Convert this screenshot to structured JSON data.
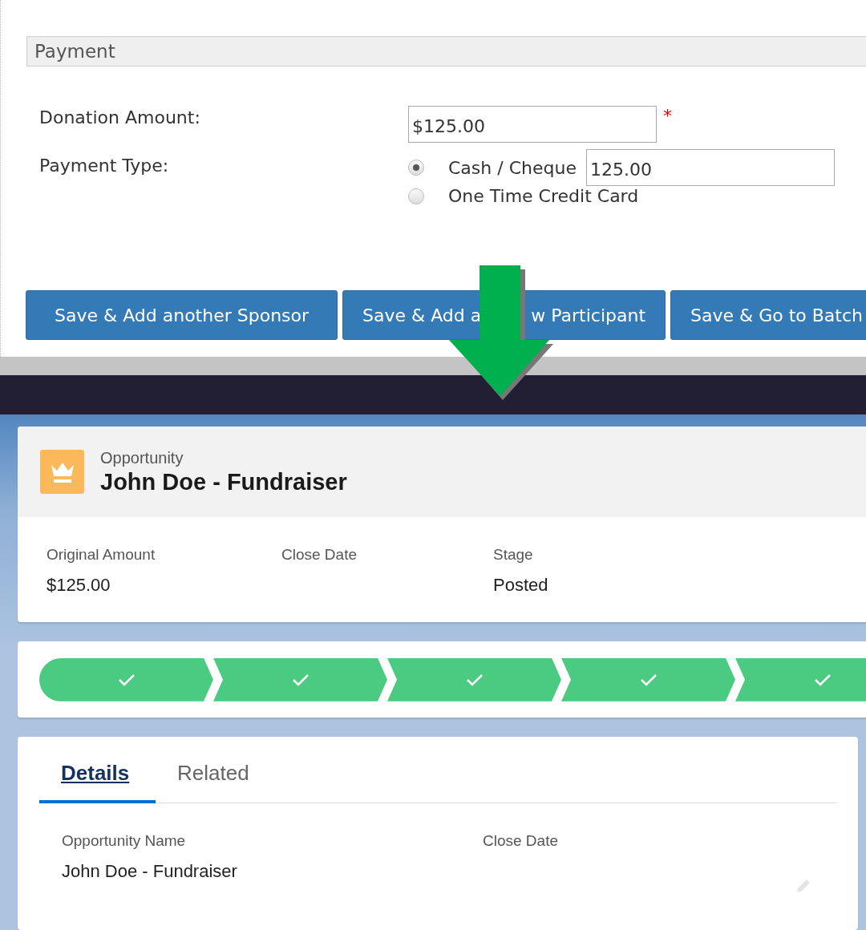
{
  "payment_form": {
    "section_title": "Payment",
    "fields": [
      {
        "label": "Donation Amount:",
        "value": "$125.00",
        "required_mark": "*"
      },
      {
        "label": "Payment Type:"
      }
    ],
    "payment_options": [
      {
        "label": "Cash / Cheque",
        "selected": true,
        "amount": "125.00"
      },
      {
        "label": "One Time Credit Card",
        "selected": false
      }
    ],
    "buttons": [
      {
        "label_parts": [
          "Save & Add another Sponsor"
        ]
      },
      {
        "label_parts": [
          "Save & Add a",
          "w Participant"
        ]
      },
      {
        "label_parts": [
          "Save & Go to Batch"
        ]
      }
    ]
  },
  "record": {
    "object_type": "Opportunity",
    "title": "John Doe - Fundraiser",
    "highlights": [
      {
        "label": "Original Amount",
        "value": "$125.00"
      },
      {
        "label": "Close Date"
      },
      {
        "label": "Stage",
        "value": "Posted"
      }
    ],
    "path_steps": [
      {
        "complete": true
      },
      {
        "complete": true
      },
      {
        "complete": true
      },
      {
        "complete": true
      },
      {
        "complete": true
      }
    ],
    "tabs": [
      {
        "label": "Details",
        "selected": true
      },
      {
        "label": "Related",
        "selected": false
      }
    ],
    "detail_fields": [
      {
        "label": "Opportunity Name",
        "value": "John Doe - Fundraiser",
        "editable": false
      },
      {
        "label": "Close Date",
        "editable": true
      }
    ]
  }
}
